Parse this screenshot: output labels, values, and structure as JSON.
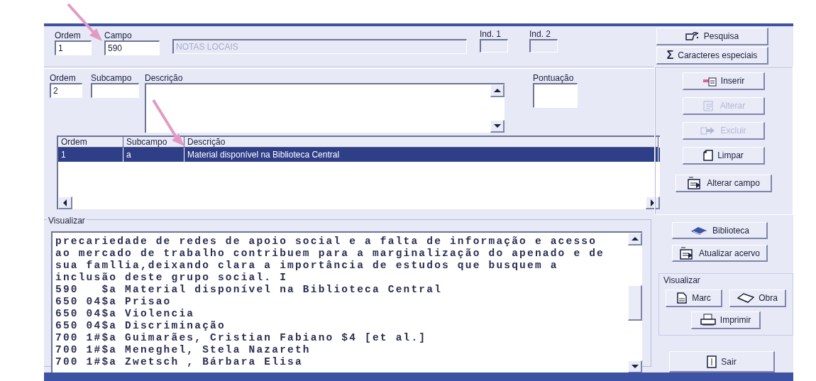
{
  "top_fields": [
    {
      "label": "Ordem",
      "value": "1",
      "disabled": false
    },
    {
      "label": "Campo",
      "value": "590",
      "disabled": false
    },
    {
      "value": "NOTAS LOCAIS",
      "disabled": true
    },
    {
      "label": "Ind. 1",
      "disabled": true
    },
    {
      "label": "Ind. 2",
      "disabled": true
    }
  ],
  "top_buttons": [
    {
      "label": "Pesquisa"
    },
    {
      "label": "Caracteres especiais",
      "icon_text": "Σ"
    }
  ],
  "subfield_fields": [
    {
      "label": "Ordem",
      "value": "2",
      "kind": "input"
    },
    {
      "label": "Subcampo",
      "kind": "input"
    },
    {
      "label": "Descrição",
      "kind": "textarea"
    },
    {
      "label": "Pontuação",
      "kind": "input"
    }
  ],
  "edit_buttons": [
    {
      "label": "Inserir",
      "disabled": false
    },
    {
      "label": "Alterar",
      "disabled": true
    },
    {
      "label": "Excluir",
      "disabled": true
    },
    {
      "label": "Limpar",
      "disabled": false
    },
    {
      "label": "Alterar campo",
      "disabled": false
    }
  ],
  "grid": {
    "columns": [
      "Ordem",
      "Subcampo",
      "Descrição"
    ],
    "rows": [
      {
        "cells": [
          "1",
          "a",
          "Material disponível na Biblioteca Central"
        ],
        "selected": true
      }
    ]
  },
  "preview": {
    "label": "Visualizar",
    "lines": [
      "precariedade de redes de apoio social e a falta de informação e acesso",
      "ao mercado de trabalho contribuem para a marginalização do apenado e de",
      "sua famllia,deixando clara a importância de estudos que busquem a",
      "inclusão deste grupo social. I",
      "590   $a Material disponível na Biblioteca Central",
      "650 04$a Prisao",
      "650 04$a Violencia",
      "650 04$a Discriminação",
      "700 1#$a Guimarães, Cristian Fabiano $4 [et al.]",
      "700 1#$a Meneghel, Stela Nazareth",
      "700 1#$a Zwetsch , Bárbara Elisa"
    ]
  },
  "library_buttons": [
    {
      "label": "Biblioteca"
    },
    {
      "label": "Atualizar acervo"
    }
  ],
  "view_group": {
    "label": "Visualizar",
    "buttons": [
      {
        "label": "Marc"
      },
      {
        "label": "Obra"
      },
      {
        "label": "Imprimir"
      }
    ]
  },
  "exit_button": {
    "label": "Sair"
  }
}
